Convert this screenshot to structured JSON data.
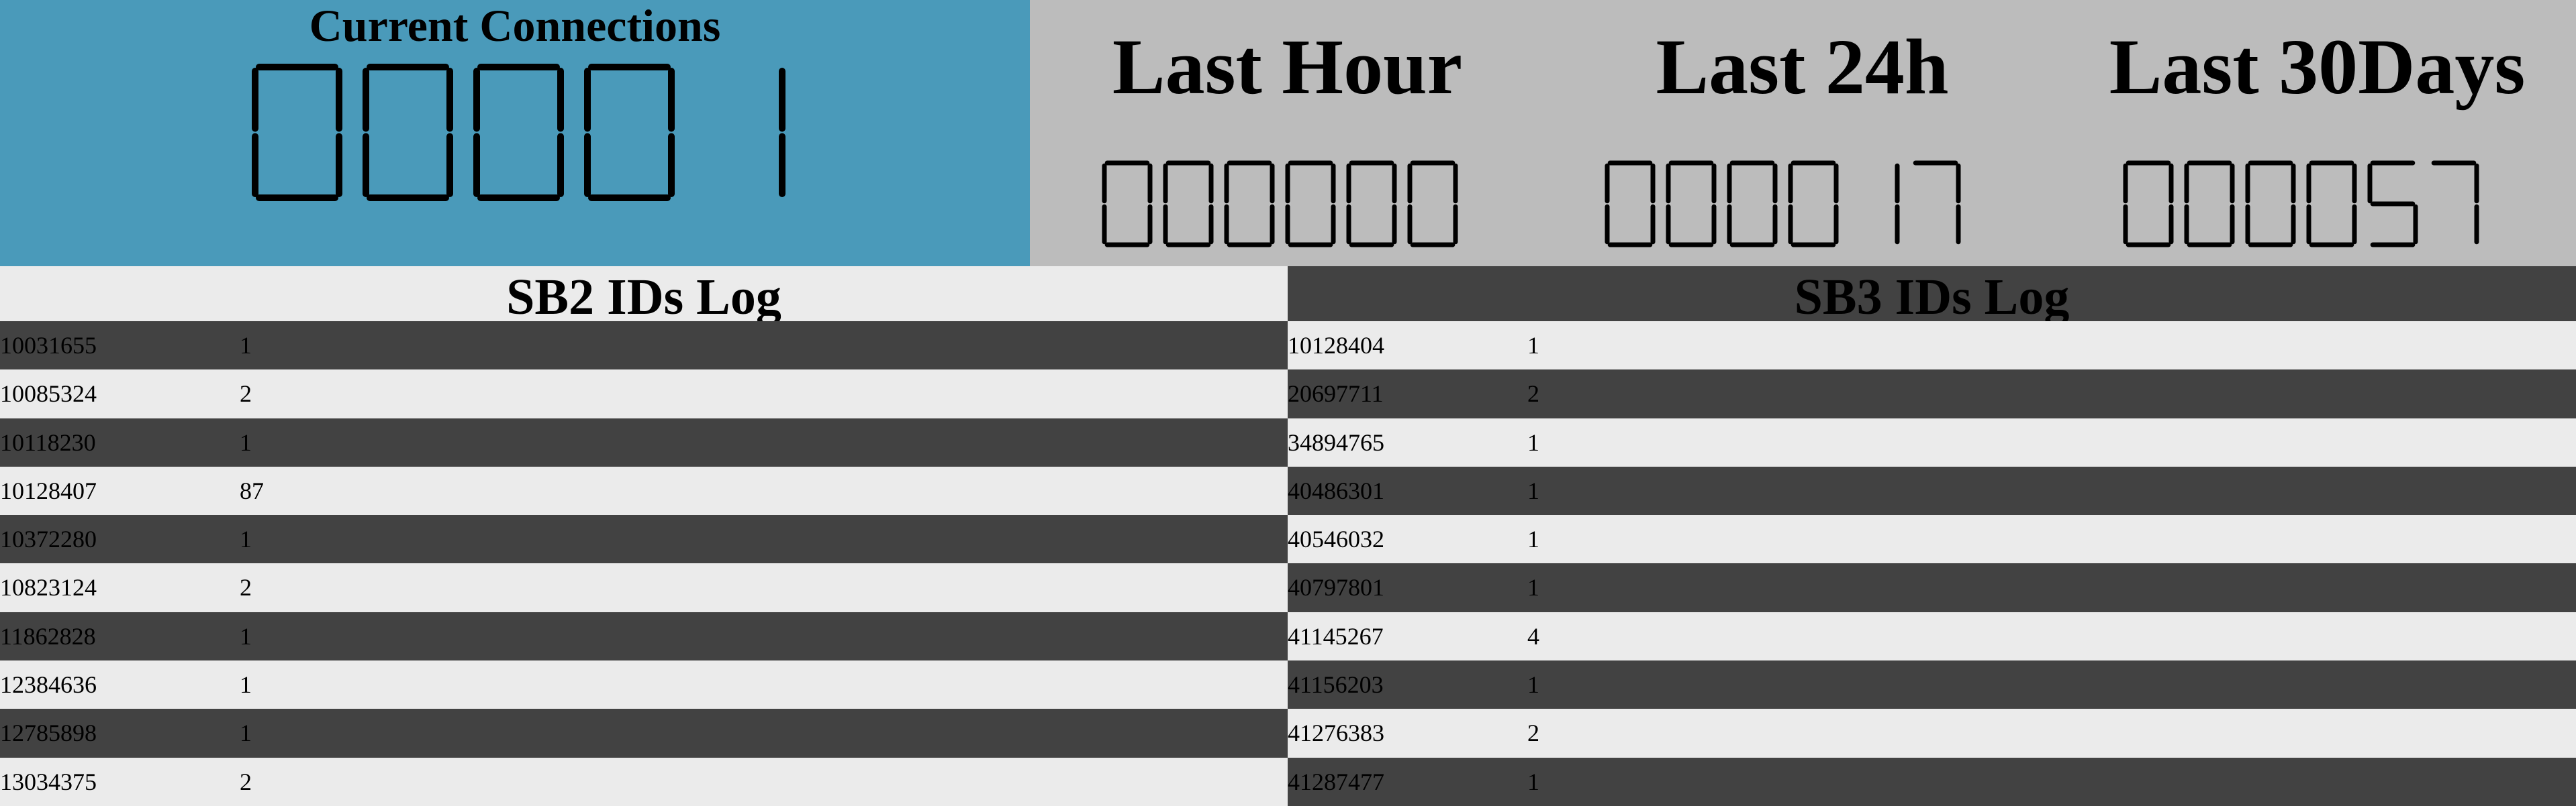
{
  "current_connections": {
    "title": "Current Connections",
    "value": "00001"
  },
  "stats": {
    "last_hour": {
      "label": "Last Hour",
      "value": "000000"
    },
    "last_24h": {
      "label": "Last 24h",
      "value": "000017"
    },
    "last_30days": {
      "label": "Last 30Days",
      "value": "000057"
    }
  },
  "sb2_log": {
    "title": "SB2 IDs Log",
    "rows": [
      {
        "id": "10031655",
        "count": "1"
      },
      {
        "id": "10085324",
        "count": "2"
      },
      {
        "id": "10118230",
        "count": "1"
      },
      {
        "id": "10128407",
        "count": "87"
      },
      {
        "id": "10372280",
        "count": "1"
      },
      {
        "id": "10823124",
        "count": "2"
      },
      {
        "id": "11862828",
        "count": "1"
      },
      {
        "id": "12384636",
        "count": "1"
      },
      {
        "id": "12785898",
        "count": "1"
      },
      {
        "id": "13034375",
        "count": "2"
      }
    ]
  },
  "sb3_log": {
    "title": "SB3 IDs Log",
    "rows": [
      {
        "id": "10128404",
        "count": "1"
      },
      {
        "id": "20697711",
        "count": "2"
      },
      {
        "id": "34894765",
        "count": "1"
      },
      {
        "id": "40486301",
        "count": "1"
      },
      {
        "id": "40546032",
        "count": "1"
      },
      {
        "id": "40797801",
        "count": "1"
      },
      {
        "id": "41145267",
        "count": "4"
      },
      {
        "id": "41156203",
        "count": "1"
      },
      {
        "id": "41276383",
        "count": "2"
      },
      {
        "id": "41287477",
        "count": "1"
      }
    ]
  },
  "colors": {
    "current_panel": "#4a9aba",
    "stats_panel": "#bcbcbc",
    "row_dark": "#424242",
    "row_light": "#ebebeb"
  }
}
